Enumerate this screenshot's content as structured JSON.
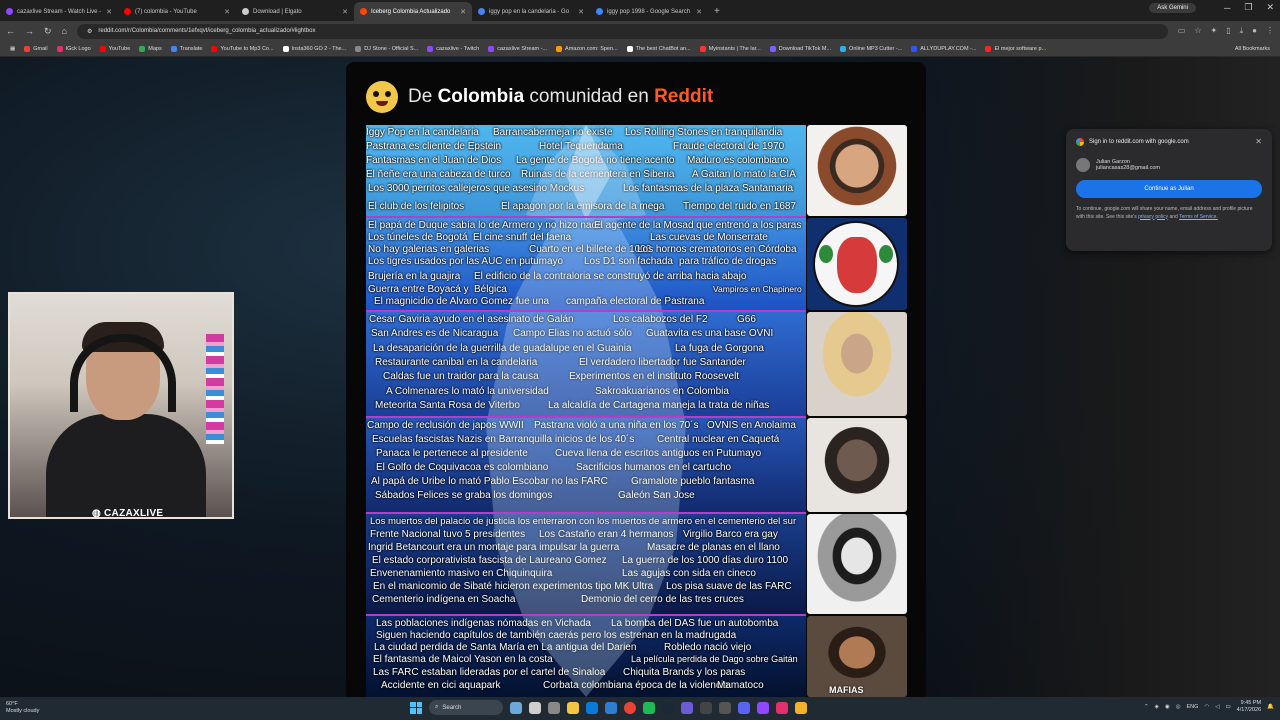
{
  "tabs": [
    {
      "label": "cazaxlive Stream - Watch Live -",
      "color": "#9146ff",
      "active": false
    },
    {
      "label": "(7) colombia - YouTube",
      "color": "#ff0000",
      "active": false
    },
    {
      "label": "Download | Elgato",
      "color": "#cccccc",
      "active": false
    },
    {
      "label": "Iceberg Colombia Actualizado",
      "color": "#ff4500",
      "active": true
    },
    {
      "label": "iggy pop en la candelaria - Go",
      "color": "#4285f4",
      "active": false
    },
    {
      "label": "iggy pop 1998 - Google Search",
      "color": "#4285f4",
      "active": false
    }
  ],
  "tab_new": "+",
  "ask_gemini": "Ask Gemini",
  "window_controls": {
    "minimize": "─",
    "maximize": "❐",
    "close": "✕"
  },
  "url": "reddit.com/r/Colombia/comments/1efxqvt/iceberg_colombia_actualizado/#lightbox",
  "bookmarks": [
    {
      "label": "Gmail",
      "color": "#ea4335"
    },
    {
      "label": "IGck Logo",
      "color": "#e1306c"
    },
    {
      "label": "YouTube",
      "color": "#ff0000"
    },
    {
      "label": "Maps",
      "color": "#34a853"
    },
    {
      "label": "Translate",
      "color": "#4285f4"
    },
    {
      "label": "YouTube to Mp3 Co...",
      "color": "#ff0000"
    },
    {
      "label": "Insta360 GO 2 - The...",
      "color": "#ffffff"
    },
    {
      "label": "DJ Stone - Official S...",
      "color": "#888888"
    },
    {
      "label": "cazaxlive - Twitch",
      "color": "#9146ff"
    },
    {
      "label": "cazaxlive Stream -...",
      "color": "#9146ff"
    },
    {
      "label": "Amazon.com: Spen...",
      "color": "#ff9900"
    },
    {
      "label": "The best ChatBot an...",
      "color": "#ffffff"
    },
    {
      "label": "Myinstants | The lar...",
      "color": "#ff3333"
    },
    {
      "label": "Download TikTok M...",
      "color": "#7b61ff"
    },
    {
      "label": "Online MP3 Cutter -...",
      "color": "#2bb0e8"
    },
    {
      "label": "ALLYDUPLAY.COM -...",
      "color": "#3355ff"
    },
    {
      "label": "El mejor software p...",
      "color": "#ff2222"
    }
  ],
  "all_bookmarks": "All Bookmarks",
  "reddit": {
    "title_prefix": "De",
    "title_country": "Colombia",
    "title_middle": "comunidad en",
    "title_brand": "Reddit",
    "brand_color": "#ff5a1f"
  },
  "tiers": [
    {
      "items": [
        "Iggy Pop en la candelaria",
        "Barrancabermeja no existe",
        "Los Rolling Stones en tranquilandia",
        "Pastrana es cliente de Epstein",
        "Hotel Tequendama",
        "Fraude electoral de 1970",
        "Fantasmas en el Juan de Dios",
        "La gente de Bogotá no tiene acento",
        "Maduro es colombiano",
        "El ñeñe era una cabeza de turco",
        "Ruinas de la cementera en Siberia",
        "A Gaitan lo mató la CIA",
        "Los 3000 perritos callejeros que asesino Mockus",
        "Los fantasmas de la plaza Santamaria",
        "El club de los felipitos",
        "El apagon por la emisora de la mega",
        "Tiempo del ruido en 1687"
      ]
    },
    {
      "items": [
        "El papá de Duque sabía lo de Armero y no hizo nada",
        "El agente de la Mosad que entrenó a los paras",
        "Los túneles de Bogotá",
        "El cine snuff del faena",
        "Las cuevas de Monserrate",
        "No hay galerias en galerias",
        "Cuarto en el billete de 1000",
        "Los hornos crematorios en Córdoba",
        "Los tigres usados por las AUC en putumayo",
        "Los D1 son fachada",
        "para tráfico de drogas",
        "Brujería en la guajira",
        "El edificio de la contraloria se construyó de arriba hacia abajo",
        "Guerra entre Boyacá y",
        "Bélgica",
        "Vampiros en Chapinero",
        "El magnicidio de Alvaro Gomez fue una",
        "campaña electoral de Pastrana"
      ]
    },
    {
      "items": [
        "Cesar Gaviria ayudo en el asesinato de Galán",
        "Los calabozos del F2",
        "G66",
        "San Andres es de Nicaragua",
        "Campo Elias no actuó sólo",
        "Guatavita es una base OVNI",
        "La desaparición de la guerrilla de guadalupe en el Guainia",
        "La fuga de Gorgona",
        "Restaurante canibal en la candelaria",
        "El verdadero libertador fue Santander",
        "Caldas fue un traidor para la causa",
        "Experimentos en el instituto Roosevelt",
        "A Colmenares lo mató la universidad",
        "Sakroakuarianos en Colombia",
        "Meteorita Santa Rosa de Viterbo",
        "La alcaldía de Cartagena maneja la trata de niñas"
      ]
    },
    {
      "items": [
        "Campo de reclusión de japos WWII",
        "Pastrana violó a una niña en los 70´s",
        "OVNIS en Anolaima",
        "Escuelas fascistas Nazis en Barranquilla inicios de los 40´s",
        "Central nuclear en Caquetá",
        "Panaca le pertenece al presidente",
        "Cueva llena de escritos antiguos en Putumayo",
        "El Golfo de Coquivacoa es colombiano",
        "Sacrificios humanos en el cartucho",
        "Al papá de Uribe lo mató Pablo Escobar no las FARC",
        "Gramalote pueblo fantasma",
        "Sábados Felices se graba los domingos",
        "Galeón San Jose"
      ]
    },
    {
      "items": [
        "Los muertos del palacio de justicia los enterraron con los muertos de armero en el cementerio del sur",
        "Frente Nacional tuvo 5 presidentes",
        "Los Castaño eran 4 hermanos",
        "Virgilio Barco era gay",
        "Ingrid Betancourt era un montaje para impulsar la guerra",
        "Masacre de planas en el llano",
        "El estado corporativista fascista de Laureano Gomez",
        "La guerra de los 1000 días duro 1100",
        "Envenenamiento masivo en Chiquinquira",
        "Las agujas con sida en cineco",
        "En el manicomio de Sibaté hicieron experimentos tipo MK Ultra",
        "Los pisa suave de las FARC",
        "Cementerio indígena en Soacha",
        "Demonio del cerro de las tres cruces"
      ]
    },
    {
      "items": [
        "Las poblaciones indígenas nómadas en Vichada",
        "La bomba del DAS fue un autobomba",
        "Siguen haciendo capítulos de también caerás pero los estrenan en la madrugada",
        "La ciudad perdida de Santa María en La antigua del Darien",
        "Robledo nació viejo",
        "El fantasma de Maicol Yason en la costa",
        "La película perdida de Dago sobre Gaitán",
        "Las FARC estaban lideradas por el cartel de Sinaloa",
        "Chiquita Brands y los paras",
        "Accidente en cici aquapark",
        "Corbata colombiana época de la violencia",
        "Mamatoco"
      ]
    }
  ],
  "portrait_caption": "MAFIAS",
  "webcam_name": "CAZAXLIVE",
  "google_popup": {
    "title": "Sign in to reddit.com with google.com",
    "account_name": "Julian Garzon",
    "account_email": "juliancasas28@gmail.com",
    "button": "Continue as Julian",
    "note": "To continue, google.com will share your name, email address and profile picture with this site. See this site's",
    "privacy": "privacy policy",
    "and": "and",
    "terms": "Terms of Service."
  },
  "taskbar": {
    "temp": "60°F",
    "weather": "Mostly cloudy",
    "search": "Search",
    "lang": "ENG",
    "time": "9:45 PM",
    "date": "4/17/2026"
  }
}
